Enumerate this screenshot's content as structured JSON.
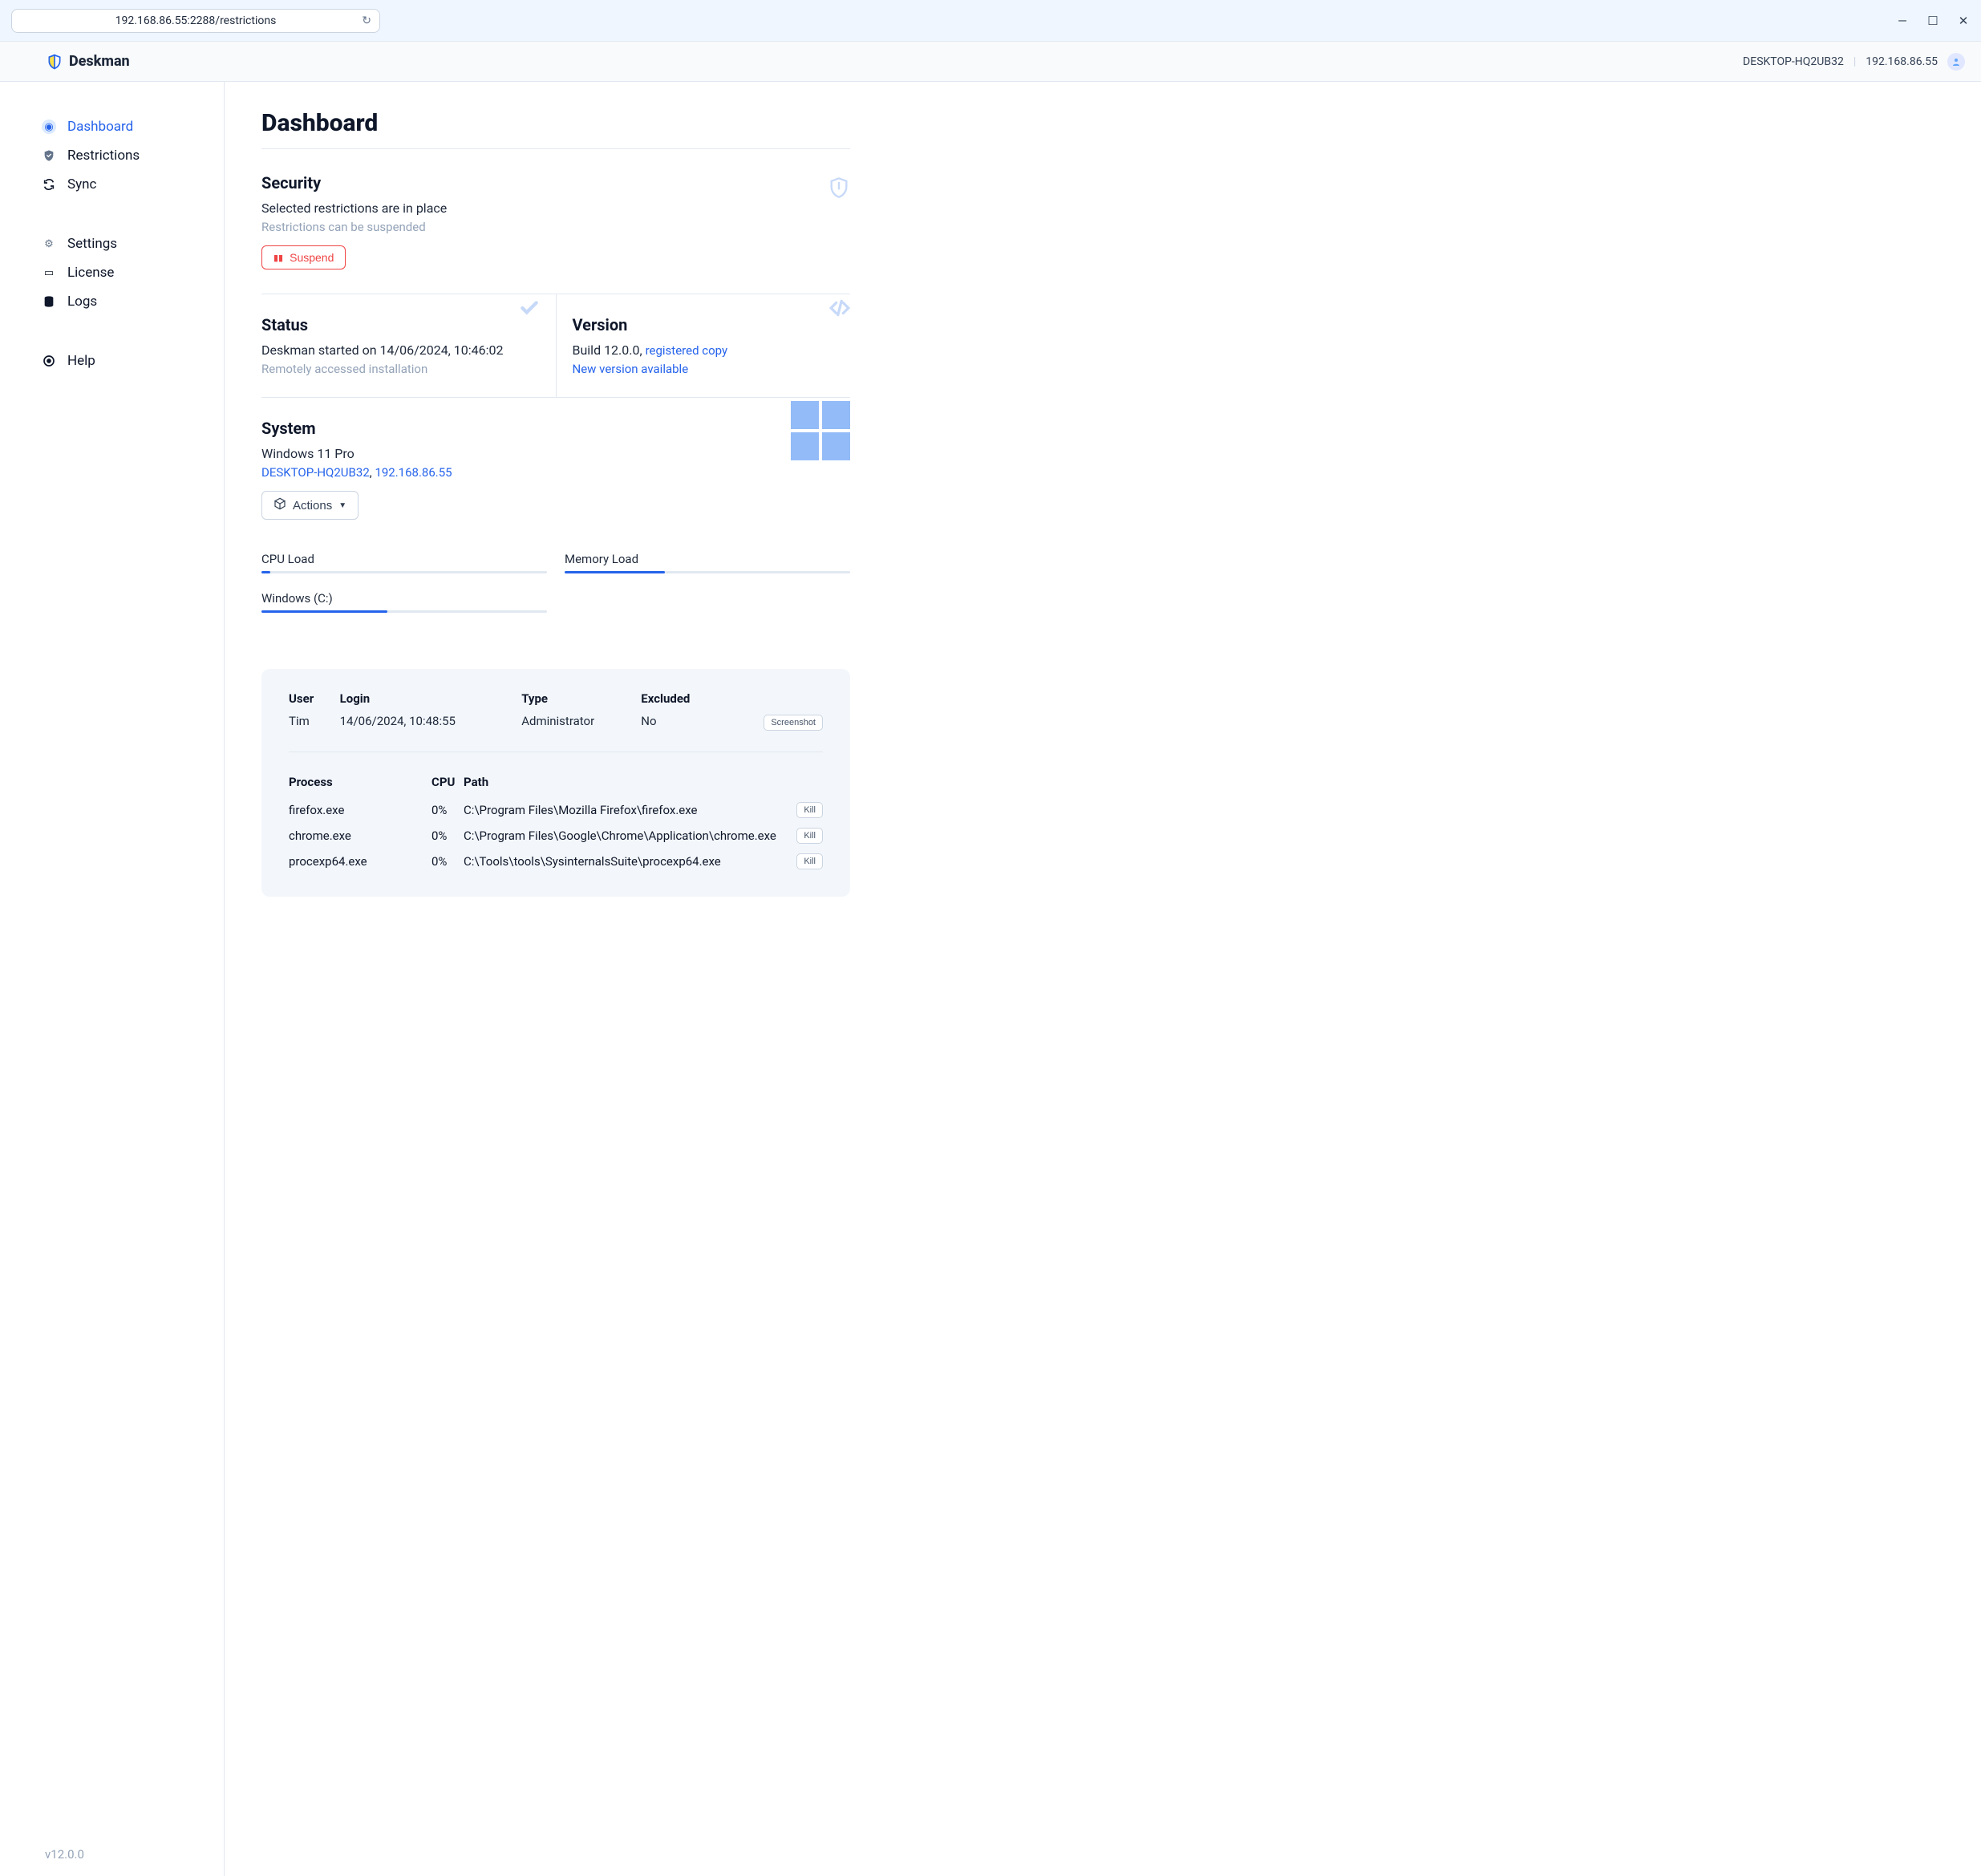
{
  "browser": {
    "url": "192.168.86.55:2288/restrictions"
  },
  "brand": "Deskman",
  "header": {
    "hostname": "DESKTOP-HQ2UB32",
    "ip": "192.168.86.55"
  },
  "nav": {
    "dashboard": "Dashboard",
    "restrictions": "Restrictions",
    "sync": "Sync",
    "settings": "Settings",
    "license": "License",
    "logs": "Logs",
    "help": "Help"
  },
  "footer_version": "v12.0.0",
  "page_title": "Dashboard",
  "security": {
    "title": "Security",
    "line1": "Selected restrictions are in place",
    "line2": "Restrictions can be suspended",
    "suspend_label": "Suspend"
  },
  "status": {
    "title": "Status",
    "line1": "Deskman started on 14/06/2024, 10:46:02",
    "line2": "Remotely accessed installation"
  },
  "version": {
    "title": "Version",
    "build_prefix": "Build 12.0.0, ",
    "registered": "registered copy",
    "new_version": "New version available"
  },
  "system": {
    "title": "System",
    "os": "Windows 11 Pro",
    "hostname": "DESKTOP-HQ2UB32",
    "comma": ", ",
    "ip": "192.168.86.55",
    "actions_label": "Actions"
  },
  "gauges": {
    "cpu": {
      "label": "CPU Load",
      "pct": 3
    },
    "mem": {
      "label": "Memory Load",
      "pct": 35
    },
    "disk": {
      "label": "Windows (C:)",
      "pct": 44
    }
  },
  "user_table": {
    "headers": {
      "user": "User",
      "login": "Login",
      "type": "Type",
      "excluded": "Excluded"
    },
    "row": {
      "user": "Tim",
      "login": "14/06/2024, 10:48:55",
      "type": "Administrator",
      "excluded": "No"
    },
    "screenshot_label": "Screenshot"
  },
  "proc_table": {
    "headers": {
      "process": "Process",
      "cpu": "CPU",
      "path": "Path"
    },
    "kill_label": "Kill",
    "rows": [
      {
        "name": "firefox.exe",
        "cpu": "0%",
        "path": "C:\\Program Files\\Mozilla Firefox\\firefox.exe"
      },
      {
        "name": "chrome.exe",
        "cpu": "0%",
        "path": "C:\\Program Files\\Google\\Chrome\\Application\\chrome.exe"
      },
      {
        "name": "procexp64.exe",
        "cpu": "0%",
        "path": "C:\\Tools\\tools\\SysinternalsSuite\\procexp64.exe"
      }
    ]
  }
}
